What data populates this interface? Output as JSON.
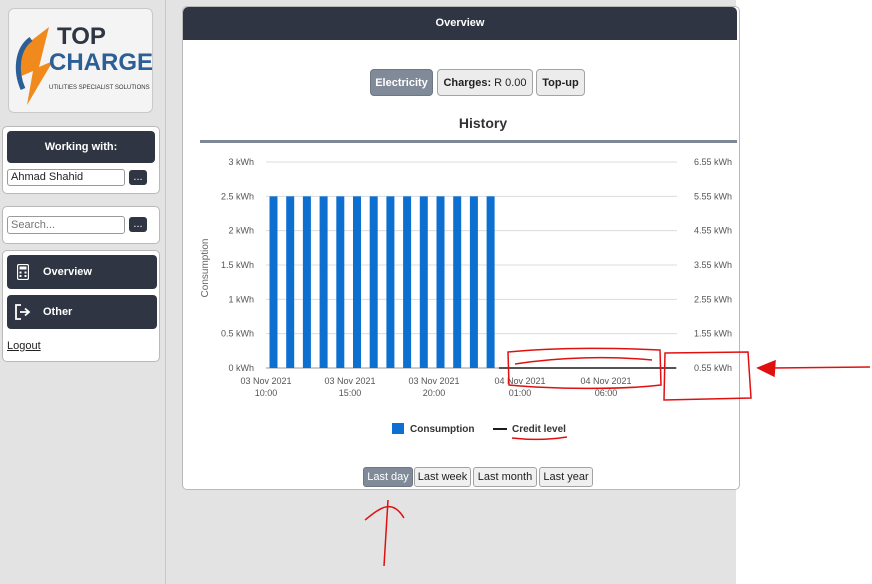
{
  "brand": {
    "top": "TOP",
    "charge": "CHARGE",
    "tagline": "UTILITIES SPECIALIST SOLUTIONS"
  },
  "sidebar": {
    "working_with_label": "Working with:",
    "user_value": "Ahmad Shahid",
    "dots_label": "...",
    "search_placeholder": "Search...",
    "nav": [
      {
        "label": "Overview",
        "icon": "calculator-icon"
      },
      {
        "label": "Other",
        "icon": "sign-out-icon"
      }
    ],
    "logout": "Logout"
  },
  "header": {
    "title": "Overview"
  },
  "tabs": {
    "electricity": "Electricity",
    "charges_label": "Charges:",
    "charges_value": "R 0.00",
    "topup": "Top-up"
  },
  "chart_title": "History",
  "chart_data": {
    "type": "bar",
    "ylabel": "Consumption",
    "left_ticks": [
      "3 kWh",
      "2.5 kWh",
      "2 kWh",
      "1.5 kWh",
      "1 kWh",
      "0.5 kWh",
      "0 kWh"
    ],
    "right_ticks": [
      "6.55 kWh",
      "5.55 kWh",
      "4.55 kWh",
      "3.55 kWh",
      "2.55 kWh",
      "1.55 kWh",
      "0.55 kWh"
    ],
    "x_ticks": [
      [
        "03 Nov 2021",
        "10:00"
      ],
      [
        "03 Nov 2021",
        "15:00"
      ],
      [
        "03 Nov 2021",
        "20:00"
      ],
      [
        "04 Nov 2021",
        "01:00"
      ],
      [
        "04 Nov 2021",
        "06:00"
      ]
    ],
    "ylim": [
      0,
      3
    ],
    "series": [
      {
        "name": "Consumption",
        "values": [
          2.5,
          2.5,
          2.5,
          2.5,
          2.5,
          2.5,
          2.5,
          2.5,
          2.5,
          2.5,
          2.5,
          2.5,
          2.5,
          2.5
        ],
        "color": "#0d6fd0"
      },
      {
        "name": "Credit level",
        "values": [
          0.55
        ],
        "color": "#1c1c1c"
      }
    ]
  },
  "ranges": [
    "Last day",
    "Last week",
    "Last month",
    "Last year"
  ],
  "colors": {
    "dark": "#2f3542",
    "bar": "#0d6fd0",
    "annotation": "#e01010"
  }
}
